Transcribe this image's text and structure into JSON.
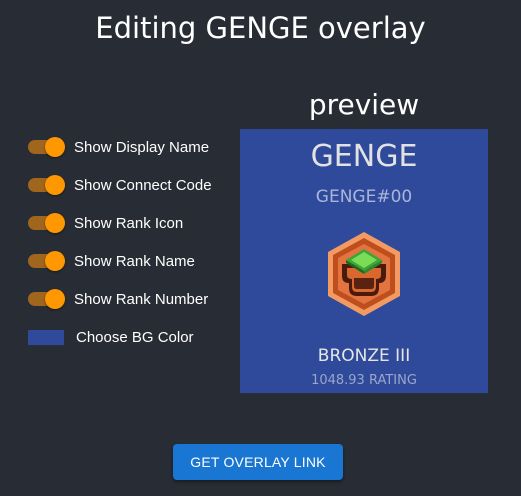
{
  "page": {
    "title": "Editing GENGE overlay"
  },
  "settings": {
    "items": [
      {
        "label": "Show Display Name",
        "enabled": true
      },
      {
        "label": "Show Connect Code",
        "enabled": true
      },
      {
        "label": "Show Rank Icon",
        "enabled": true
      },
      {
        "label": "Show Rank Name",
        "enabled": true
      },
      {
        "label": "Show Rank Number",
        "enabled": true
      }
    ],
    "bg_color": {
      "label": "Choose BG Color",
      "value": "#2f4a9a"
    }
  },
  "preview": {
    "heading": "preview",
    "display_name": "GENGE",
    "connect_code": "GENGE#00",
    "rank_icon": "bronze-rank-icon",
    "rank_name": "BRONZE III",
    "rating": "1048.93 RATING"
  },
  "actions": {
    "get_link_label": "GET OVERLAY LINK"
  },
  "colors": {
    "background": "#282c34",
    "toggle_on_thumb": "#ff9800",
    "toggle_on_track": "#a0661e",
    "button": "#1976d2",
    "preview_bg": "#2f4a9a"
  }
}
